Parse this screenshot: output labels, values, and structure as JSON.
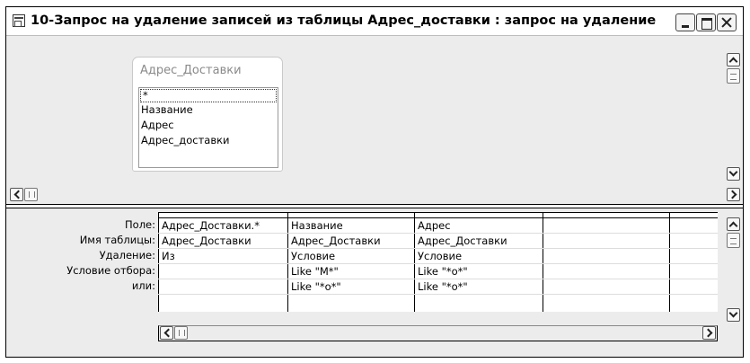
{
  "window": {
    "title": "10-Запрос на удаление записей из таблицы Адрес_доставки : запрос на удаление"
  },
  "table": {
    "name": "Адрес_Доставки",
    "fields": [
      "*",
      "Название",
      "Адрес",
      "Адрес_доставки"
    ]
  },
  "grid": {
    "row_labels": {
      "field": "Поле:",
      "table": "Имя таблицы:",
      "delete": "Удаление:",
      "criteria": "Условие отбора:",
      "or": "или:"
    },
    "columns": [
      {
        "field": "Адрес_Доставки.*",
        "table": "Адрес_Доставки",
        "delete": "Из",
        "criteria": "",
        "or": ""
      },
      {
        "field": "Название",
        "table": "Адрес_Доставки",
        "delete": "Условие",
        "criteria": "Like \"М*\"",
        "or": "Like \"*о*\""
      },
      {
        "field": "Адрес",
        "table": "Адрес_Доставки",
        "delete": "Условие",
        "criteria": "Like \"*о*\"",
        "or": "Like \"*о*\""
      }
    ]
  }
}
